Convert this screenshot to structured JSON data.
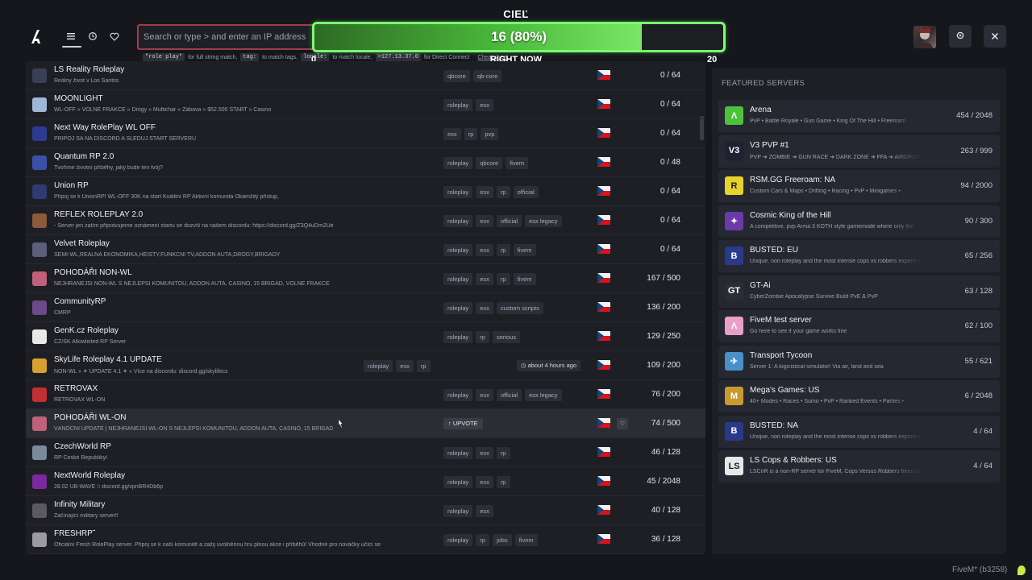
{
  "nav": {
    "list_icon": "list-icon",
    "history_icon": "history-icon",
    "favorites_icon": "heart-icon"
  },
  "search": {
    "placeholder": "Search or type > and enter an IP address",
    "hint_chip_1": "\"role play\"",
    "hint_text_1": "for full string match,",
    "hint_chip_2": "tag:",
    "hint_text_2": "to match tags,",
    "hint_chip_3": "locale:",
    "hint_text_3": "to match locale,",
    "hint_chip_4": ">127.13.37.0",
    "hint_text_4": "for Direct Connect",
    "cheat_sheet": "Cheat sheet"
  },
  "goal": {
    "title": "CIEĽ",
    "value_text": "16 (80%)",
    "fraction": 0.8,
    "subtitle": "RIGHT NOW",
    "min": "0",
    "max": "20",
    "bar_color": "#48b73a",
    "border_color": "#7bff6f"
  },
  "header_buttons": {
    "settings_icon": "gear-icon",
    "close_icon": "close-icon"
  },
  "servers": [
    {
      "name": "LS Reality Roleplay",
      "desc": "Reálny život v Los Santos",
      "tags": [
        "qbcore",
        "qb-core"
      ],
      "count": "0 / 64",
      "icon_color": "#3a3f55"
    },
    {
      "name": "MOONLIGHT",
      "desc": "WL-OFF » VOLNÉ FRAKCE » Drogy » Multichar » Zábava » $52.500 START » Casino",
      "tags": [
        "roleplay",
        "esx"
      ],
      "count": "0 / 64",
      "icon_color": "#9fb6d6"
    },
    {
      "name": "Next Way RolePlay WL OFF",
      "desc": "PRIPOJ SA NA DISCORD A SLEDUJ START SERVERU",
      "tags": [
        "esx",
        "rp",
        "pvp"
      ],
      "count": "0 / 64",
      "icon_color": "#2d3a8f"
    },
    {
      "name": "Quantum RP 2.0",
      "desc": "Tvoříme životní příběhy, jaký bude ten tvůj?",
      "tags": [
        "roleplay",
        "qbcore",
        "fivem"
      ],
      "count": "0 / 48",
      "icon_color": "#3c4fa8"
    },
    {
      "name": "Union RP",
      "desc": "Připoj se k UnionRP! WL-OFF 30K na start Kvalitní RP Aktivní komunita Okamžitý přístup,",
      "tags": [
        "roleplay",
        "esx",
        "rp",
        "official"
      ],
      "count": "0 / 64",
      "icon_color": "#2f3a70"
    },
    {
      "name": "REFLEX ROLEPLAY 2.0",
      "desc": "- Server jen zatím připravujeme oznámení startu se dozvíš na našem discordu: https://discord.gg/Z3Q4uDm2Ue",
      "tags": [
        "roleplay",
        "esx",
        "official",
        "esx legacy"
      ],
      "count": "0 / 64",
      "icon_color": "#8a5a3a"
    },
    {
      "name": "Velvet Roleplay",
      "desc": "SEMI-WL,REALNA EKONOMIKA,HEISTY,FUNKCNI TV,ADDON AUTA,DROGY,BRIGADY",
      "tags": [
        "roleplay",
        "esx",
        "rp",
        "fivem"
      ],
      "count": "0 / 64",
      "icon_color": "#5a5f7a"
    },
    {
      "name": "POHODÁŘI NON-WL",
      "desc": "NEJHRANĚJŠÍ NON-WL S NEJLEPŠÍ KOMUNITOU, ADDON AUTA, CASINO, 15 BRIGÁD, VOLNÉ FRAKCE",
      "tags": [
        "roleplay",
        "esx",
        "rp",
        "fivem"
      ],
      "count": "167 / 500",
      "icon_color": "#c0607a"
    },
    {
      "name": "CommunityRP",
      "desc": "CMRP",
      "tags": [
        "roleplay",
        "esx",
        "custom scripts"
      ],
      "count": "136 / 200",
      "icon_color": "#6a4a8a"
    },
    {
      "name": "GenK.cz Roleplay",
      "desc": "CZ/SK Allowlisted RP Server",
      "tags": [
        "roleplay",
        "rp",
        "serious"
      ],
      "count": "129 / 250",
      "icon_color": "#e8e8ea"
    },
    {
      "name": "SkyLife Roleplay 4.1 UPDATE",
      "desc": "NON-WL » ✦ UPDATE 4.1 ✦ » Více na discordu: discord.gg/skylifecz",
      "tags": [
        "roleplay",
        "esx",
        "rp"
      ],
      "count": "109 / 200",
      "icon_color": "#d9a030",
      "time": "about 4 hours ago"
    },
    {
      "name": "RETROVAX",
      "desc": "RETROVAX WL-ON",
      "tags": [
        "roleplay",
        "esx",
        "official",
        "esx legacy"
      ],
      "count": "76 / 200",
      "icon_color": "#c03030"
    },
    {
      "name": "POHODÁŘI WL-ON",
      "desc": "VÁNOČNÍ UPDATE | NEJHRANĚJŠÍ WL-ON S NEJLEPŠÍ KOMUNITOU, ADDON AUTA, CASINO, 15 BRIGÁD",
      "tags": [],
      "count": "74 / 500",
      "icon_color": "#c0607a",
      "upvote": "UPVOTE"
    },
    {
      "name": "CzechWorld RP",
      "desc": "RP České Republiky!",
      "tags": [
        "roleplay",
        "esx",
        "rp"
      ],
      "count": "46 / 128",
      "icon_color": "#7a8a9a"
    },
    {
      "name": "NextWorld Roleplay",
      "desc": "28.02 UB-WAVE ⁞⁞ discord.gg/vpnBR4Db6p",
      "tags": [
        "roleplay",
        "esx",
        "rp"
      ],
      "count": "45 / 2048",
      "icon_color": "#7a2aa0"
    },
    {
      "name": "Infinity Military",
      "desc": "Začínající military server!!",
      "tags": [
        "roleplay",
        "esx"
      ],
      "count": "40 / 128",
      "icon_color": "#5a5a60"
    },
    {
      "name": "FRESHRP˜",
      "desc": "Oficiální Fresh RolePlay server. Připoj se k naší komunitě a zažij uvolněnou hru plnou akce i příběhů! Vhodné pro nováčky učící se",
      "tags": [
        "roleplay",
        "rp",
        "jobs",
        "fivem"
      ],
      "count": "36 / 128",
      "icon_color": "#9a9aa0"
    }
  ],
  "featured": {
    "title": "FEATURED SERVERS",
    "items": [
      {
        "name": "Arena",
        "desc": "PvP • Battle Royale • Gun Game • King Of The Hill • Freeroam",
        "count": "454 / 2048",
        "icon_color": "#4cc23a",
        "icon_glyph": "Λ"
      },
      {
        "name": "V3 PVP #1",
        "desc": "PVP ➜ ZOMBIE ➜ GUN RACE ➜ DARK ZONE ➜ FFA ➜ AIRDROPS",
        "count": "263 / 999",
        "icon_color": "#1e2230",
        "icon_glyph": "V3"
      },
      {
        "name": "RSM.GG Freeroam: NA",
        "desc": "Custom Cars & Maps • Drifting • Racing • PvP • Minigames •",
        "count": "94 / 2000",
        "icon_color": "#e5d22a",
        "icon_glyph": "R"
      },
      {
        "name": "Cosmic King of the Hill",
        "desc": "A competitive, pvp Arma 3 KOTH style gamemode where only the",
        "count": "90 / 300",
        "icon_color": "#6a3aa8",
        "icon_glyph": "✦"
      },
      {
        "name": "BUSTED: EU",
        "desc": "Unique, non roleplay and the most intense cops vs robbers experience",
        "count": "65 / 256",
        "icon_color": "#2a3a8a",
        "icon_glyph": "B"
      },
      {
        "name": "GT-Ai",
        "desc": "CyberZombie Apocalypse Survive Build PvE & PvP",
        "count": "63 / 128",
        "icon_color": "#2a2d33",
        "icon_glyph": "GT"
      },
      {
        "name": "FiveM test server",
        "desc": "Go here to see if your game works fine",
        "count": "62 / 100",
        "icon_color": "#e8a0c8",
        "icon_glyph": "Λ"
      },
      {
        "name": "Transport Tycoon",
        "desc": "Server 1: A logicistical simulator! Via air, land and sea",
        "count": "55 / 621",
        "icon_color": "#4a90c8",
        "icon_glyph": "✈"
      },
      {
        "name": "Mega's Games: US",
        "desc": "40+ Modes • Races • Sumo • PvP • Ranked Events • Parties •",
        "count": "6 / 2048",
        "icon_color": "#c89a30",
        "icon_glyph": "M"
      },
      {
        "name": "BUSTED: NA",
        "desc": "Unique, non roleplay and the most intense cops vs robbers experience",
        "count": "4 / 64",
        "icon_color": "#2a3a8a",
        "icon_glyph": "B"
      },
      {
        "name": "LS Cops & Robbers: US",
        "desc": "LSCnR is a non-RP server for FiveM, Cops Versus Robbers freeroam",
        "count": "4 / 64",
        "icon_color": "#e8e8ea",
        "icon_glyph": "LS"
      }
    ]
  },
  "footer": {
    "version": "FiveM* (b3258)"
  }
}
